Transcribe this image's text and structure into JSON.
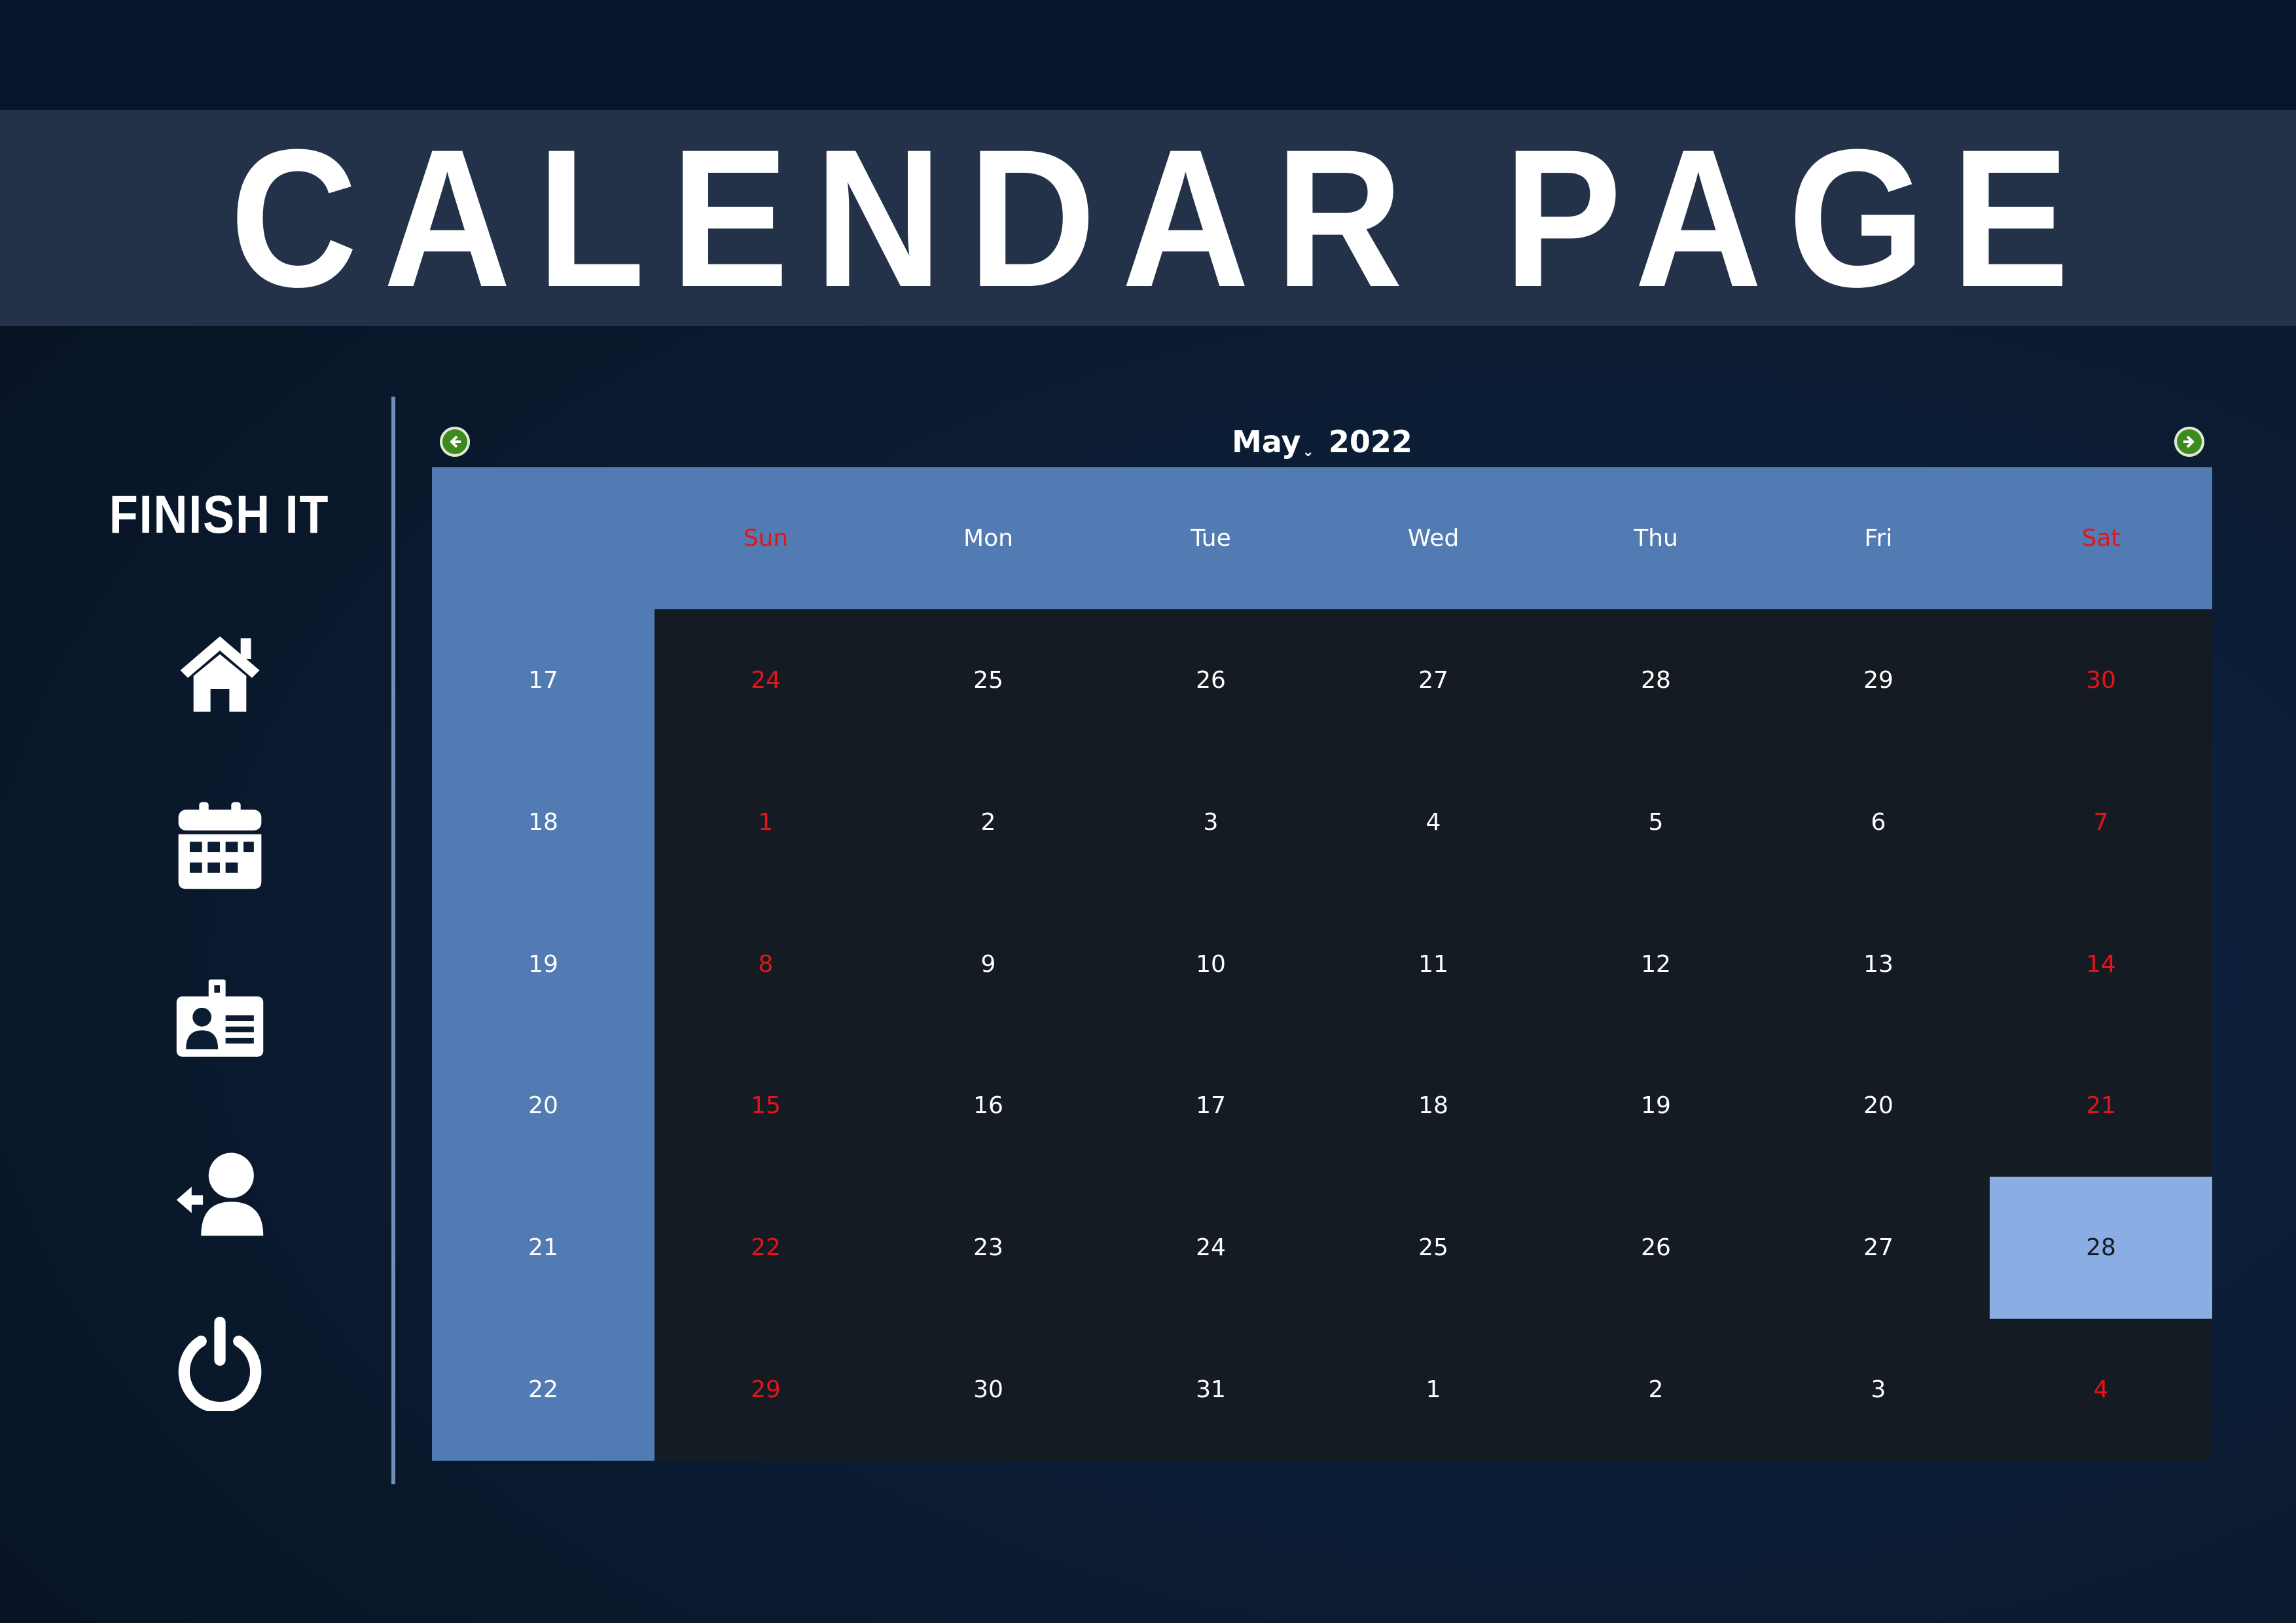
{
  "page_title": "CALENDAR PAGE",
  "sidebar": {
    "brand": "FINISH IT",
    "items": [
      {
        "icon": "home-icon"
      },
      {
        "icon": "calendar-icon"
      },
      {
        "icon": "id-card-icon"
      },
      {
        "icon": "logout-user-icon"
      },
      {
        "icon": "power-icon"
      }
    ]
  },
  "calendar": {
    "month": "May",
    "year": "2022",
    "prev_icon": "arrow-left-icon",
    "next_icon": "arrow-right-icon",
    "weekdays": [
      "Sun",
      "Mon",
      "Tue",
      "Wed",
      "Thu",
      "Fri",
      "Sat"
    ],
    "weekend_color": "#e3141a",
    "header_color": "#527bb3",
    "today_color": "#8aaee4",
    "today": {
      "week_index": 4,
      "day_index": 6
    },
    "weeks": [
      {
        "number": "17",
        "days": [
          "24",
          "25",
          "26",
          "27",
          "28",
          "29",
          "30"
        ]
      },
      {
        "number": "18",
        "days": [
          "1",
          "2",
          "3",
          "4",
          "5",
          "6",
          "7"
        ]
      },
      {
        "number": "19",
        "days": [
          "8",
          "9",
          "10",
          "11",
          "12",
          "13",
          "14"
        ]
      },
      {
        "number": "20",
        "days": [
          "15",
          "16",
          "17",
          "18",
          "19",
          "20",
          "21"
        ]
      },
      {
        "number": "21",
        "days": [
          "22",
          "23",
          "24",
          "25",
          "26",
          "27",
          "28"
        ]
      },
      {
        "number": "22",
        "days": [
          "29",
          "30",
          "31",
          "1",
          "2",
          "3",
          "4"
        ]
      }
    ]
  }
}
